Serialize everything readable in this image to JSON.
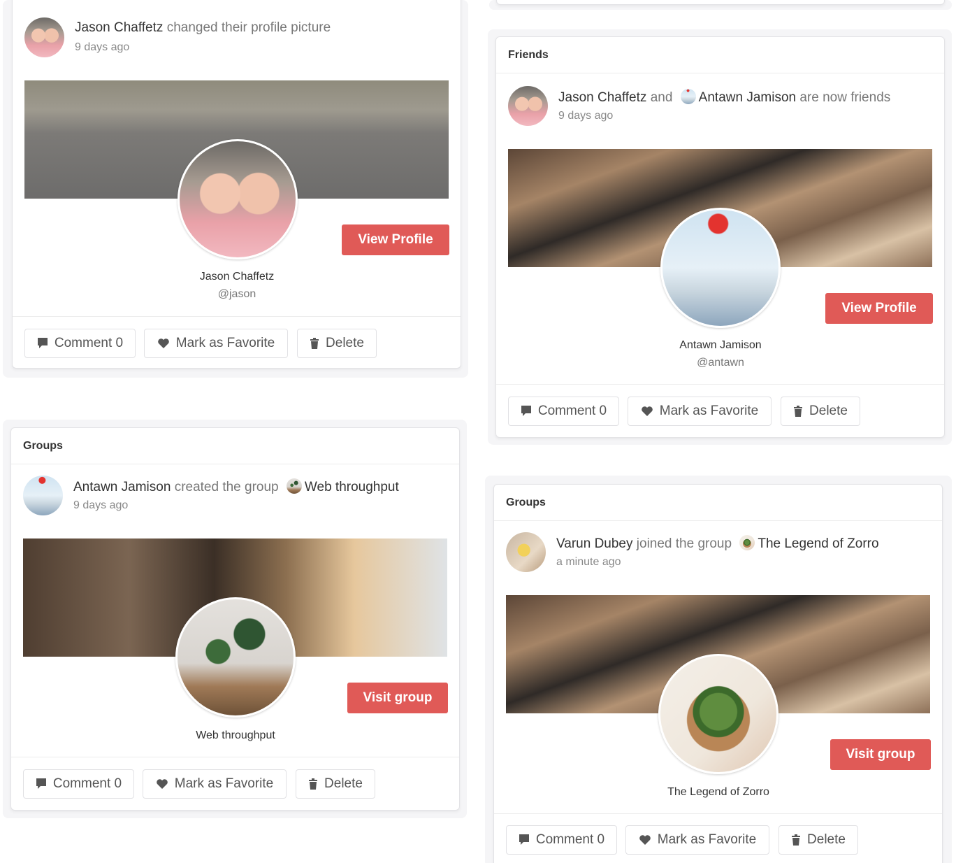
{
  "cards": [
    {
      "section_title": "",
      "actor": "Jason Chaffetz",
      "verb": "changed their profile picture",
      "target": "",
      "target_suffix": "",
      "time": "9 days ago",
      "entity_name": "Jason Chaffetz",
      "entity_handle": "@jason",
      "cta": "View Profile"
    },
    {
      "section_title": "Friends",
      "actor": "Jason Chaffetz",
      "verb": "and",
      "target": "Antawn Jamison",
      "target_suffix": "are now friends",
      "time": "9 days ago",
      "entity_name": "Antawn Jamison",
      "entity_handle": "@antawn",
      "cta": "View Profile"
    },
    {
      "section_title": "Groups",
      "actor": "Antawn Jamison",
      "verb": "created the group",
      "target": "Web throughput",
      "target_suffix": "",
      "time": "9 days ago",
      "entity_name": "Web throughput",
      "entity_handle": "",
      "cta": "Visit group"
    },
    {
      "section_title": "Groups",
      "actor": "Varun Dubey",
      "verb": "joined the group",
      "target": "The Legend of Zorro",
      "target_suffix": "",
      "time": "a minute ago",
      "entity_name": "The Legend of Zorro",
      "entity_handle": "",
      "cta": "Visit group"
    }
  ],
  "actions": {
    "comment": "Comment 0",
    "favorite": "Mark as Favorite",
    "delete": "Delete"
  },
  "colors": {
    "accent": "#e05a57",
    "card_border": "#e3e3e6",
    "muted_text": "#777777"
  },
  "icons": {
    "comment": "comment-icon",
    "favorite": "heart-icon",
    "delete": "trash-icon"
  }
}
